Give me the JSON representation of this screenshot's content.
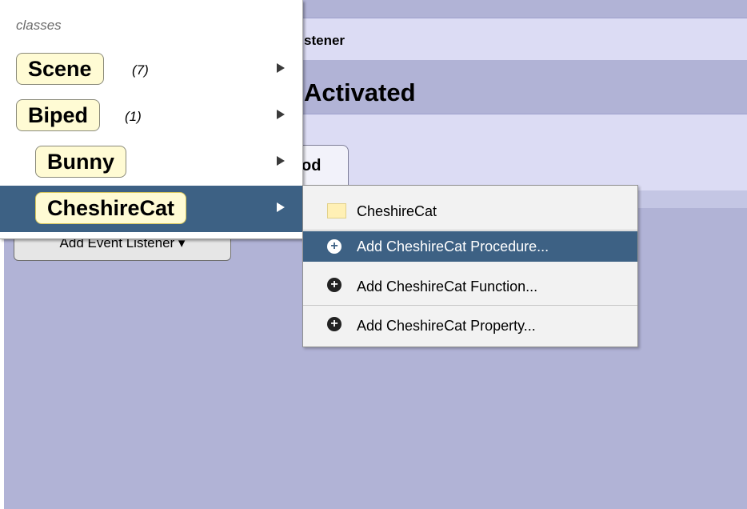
{
  "editor": {
    "tab_header_text": "stener",
    "activated_text": "Activated",
    "method_tab_text": "od",
    "add_listener_label": "Add Event Listener ▾"
  },
  "class_menu": {
    "heading": "classes",
    "items": [
      {
        "name": "Scene",
        "count": "(7)"
      },
      {
        "name": "Biped",
        "count": "(1)"
      },
      {
        "name": "Bunny",
        "count": ""
      },
      {
        "name": "CheshireCat",
        "count": ""
      }
    ]
  },
  "sub_menu": {
    "items": [
      {
        "label": "CheshireCat",
        "icon": "folder-icon"
      },
      {
        "label": "Add CheshireCat Procedure...",
        "icon": "plus-circle-icon"
      },
      {
        "label": "Add CheshireCat Function...",
        "icon": "plus-circle-icon"
      },
      {
        "label": "Add CheshireCat Property...",
        "icon": "plus-circle-icon"
      }
    ]
  },
  "colors": {
    "editor_background": "#b1b3d6",
    "selection": "#3d6184",
    "class_tag_fill": "#fffbd4"
  }
}
